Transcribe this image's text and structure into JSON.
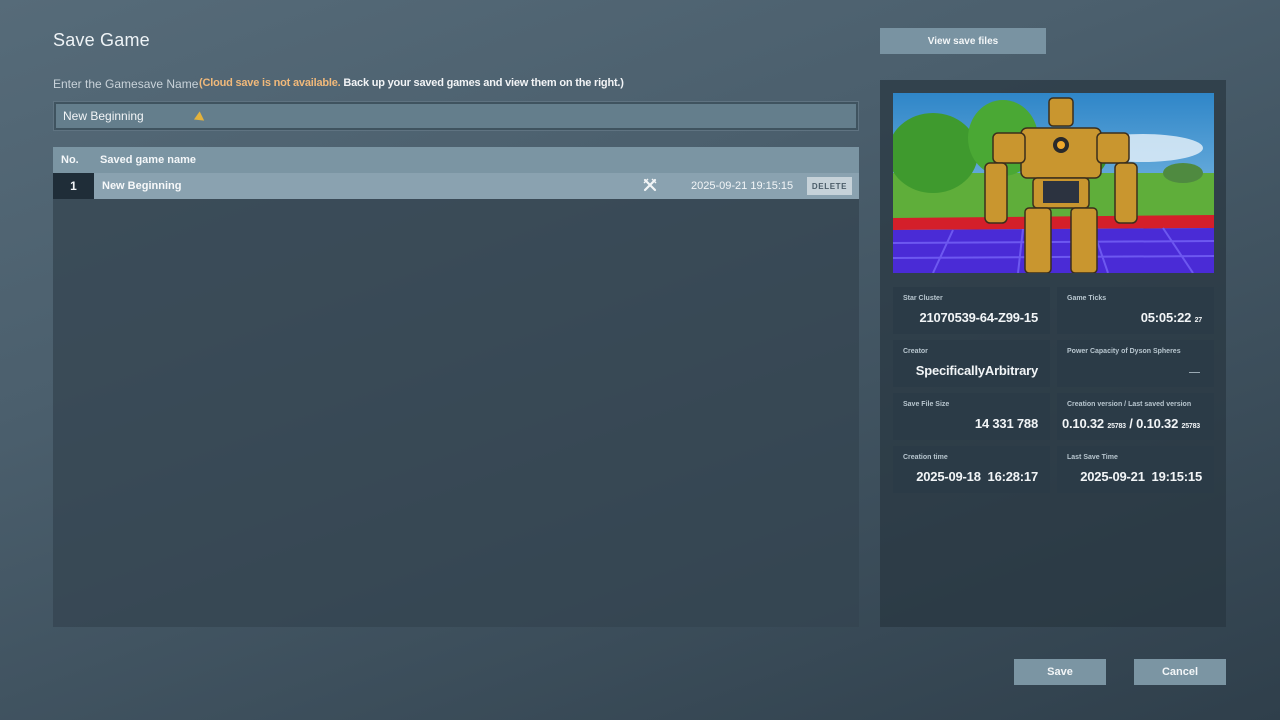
{
  "title": "Save Game",
  "name_field": {
    "label": "Enter the Gamesave Name",
    "cloud_warning": "(Cloud save is not available.",
    "cloud_note": " Back up your saved games and view them on the right.)",
    "value": "New Beginning"
  },
  "table": {
    "headers": {
      "no": "No.",
      "name": "Saved game name"
    },
    "rows": [
      {
        "no": "1",
        "name": "New Beginning",
        "time": "2025-09-21 19:15:15",
        "delete_label": "DELETE"
      }
    ]
  },
  "view_save_files": "View save files",
  "details": {
    "star_cluster": {
      "label": "Star Cluster",
      "value": "21070539-64-Z99-15"
    },
    "game_ticks": {
      "label": "Game Ticks",
      "value": "05:05:22",
      "sub": "27"
    },
    "creator": {
      "label": "Creator",
      "value": "SpecificallyArbitrary"
    },
    "dyson": {
      "label": "Power Capacity of Dyson Spheres",
      "value": "—"
    },
    "file_size": {
      "label": "Save File Size",
      "value": "14 331 788"
    },
    "version": {
      "label": "Creation version / Last saved version",
      "created": "0.10.32",
      "created_build": "25783",
      "sep": "/",
      "saved": "0.10.32",
      "saved_build": "25783"
    },
    "creation_time": {
      "label": "Creation time",
      "value": "2025-09-18  16:28:17"
    },
    "last_save": {
      "label": "Last Save Time",
      "value": "2025-09-21  19:15:15"
    }
  },
  "buttons": {
    "save": "Save",
    "cancel": "Cancel"
  },
  "colors": {
    "accent": "#7b95a3",
    "warning": "#f1b97a",
    "selected_row": "#8aa2b0"
  }
}
